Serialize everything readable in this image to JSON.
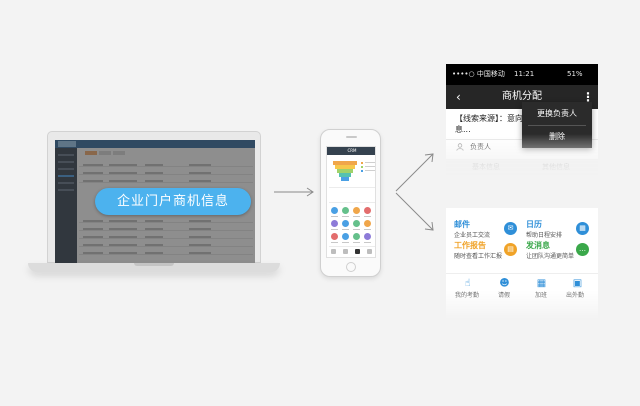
{
  "laptop": {
    "banner_text": "企业门户商机信息"
  },
  "phone": {
    "app_title": "CRM",
    "colors": {
      "funnel": [
        "#f0a64a",
        "#f7c84b",
        "#9fd26a",
        "#55c2b0",
        "#4aa0e4"
      ],
      "app_icons": [
        "#4aa0e4",
        "#65c08b",
        "#f0a64a",
        "#e36d6d",
        "#8d7bd8",
        "#4aa0e4",
        "#65c08b",
        "#f0a64a",
        "#e36d6d",
        "#4aa0e4",
        "#65c08b",
        "#8d7bd8"
      ]
    }
  },
  "card1": {
    "status_bar": {
      "carrier": "••••○ 中国移动",
      "time": "11:21",
      "battery": "51%"
    },
    "title": "商机分配",
    "headline": "【线索来源】：意向信息...",
    "owner_label": "负责人",
    "tabs": [
      "基本信息",
      "其他信息"
    ],
    "menu_items": [
      "更换负责人",
      "删除"
    ]
  },
  "card2": {
    "items": [
      {
        "title": "邮件",
        "subtitle": "企业员工交流",
        "title_color": "#2f8fd8",
        "icon_color": "#2f8fd8",
        "icon": "mail-icon"
      },
      {
        "title": "日历",
        "subtitle": "帮助日程安排",
        "title_color": "#2f8fd8",
        "icon_color": "#2f8fd8",
        "icon": "calendar-icon"
      },
      {
        "title": "工作报告",
        "subtitle": "随时查看工作汇报",
        "title_color": "#f0a328",
        "icon_color": "#f0a328",
        "icon": "report-icon"
      },
      {
        "title": "发消息",
        "subtitle": "让团队沟通更简单",
        "title_color": "#3aa84a",
        "icon_color": "#3aa84a",
        "icon": "message-icon"
      }
    ],
    "apps": [
      {
        "label": "我的考勤",
        "icon": "hand-icon"
      },
      {
        "label": "请假",
        "icon": "person-icon"
      },
      {
        "label": "加班",
        "icon": "calendar-icon"
      },
      {
        "label": "出外勤",
        "icon": "briefcase-icon"
      }
    ]
  }
}
